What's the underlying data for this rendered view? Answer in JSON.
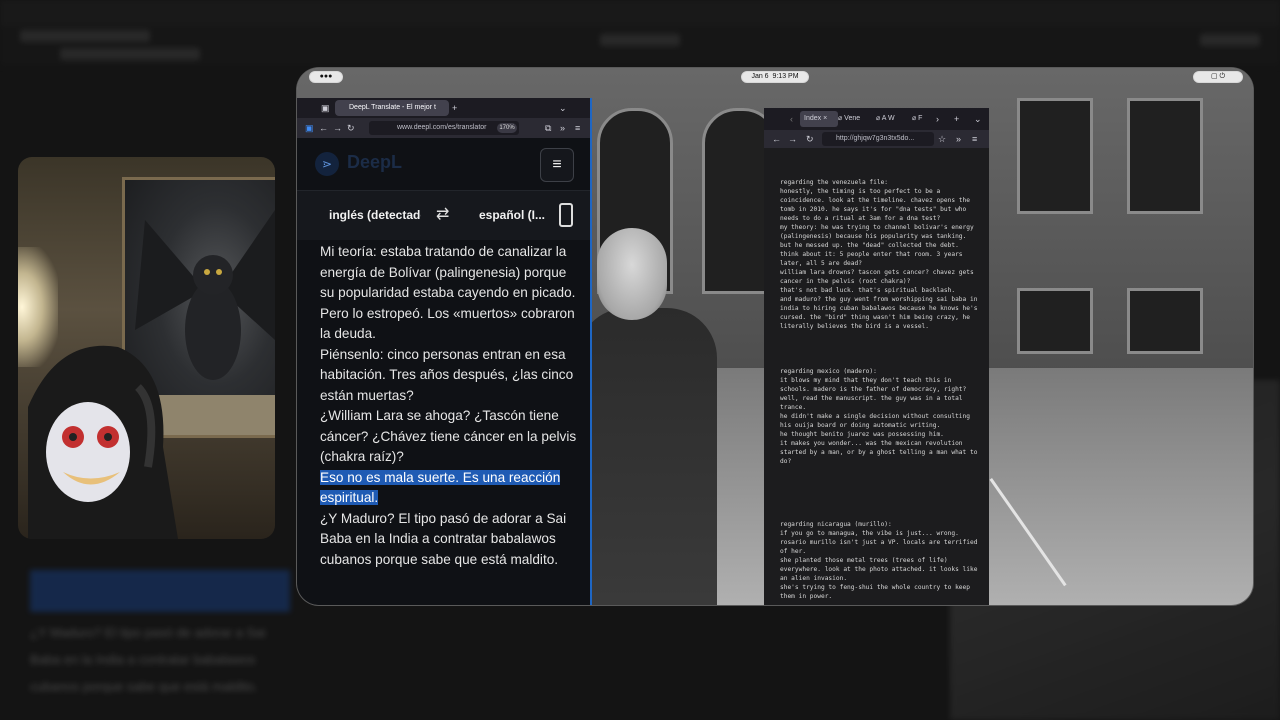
{
  "status_bar": {
    "date": "Jan 6",
    "time": "9:13 PM"
  },
  "deepl_browser": {
    "tab_title": "DeepL Translate - El mejor t",
    "url": "www.deepl.com/es/translator",
    "zoom": "170%",
    "logo_text": "DeepL",
    "source_lang": "inglés (detectado)",
    "target_lang": "español (I...",
    "paragraphs": [
      "Mi teoría: estaba tratando de canalizar la energía de Bolívar (palingenesia) porque su popularidad estaba cayendo en picado.",
      "Pero lo estropeó. Los «muertos» cobraron la deuda.",
      "Piénsenlo: cinco personas entran en esa habitación. Tres años después, ¿las cinco están muertas?",
      "¿William Lara se ahoga? ¿Tascón tiene cáncer? ¿Chávez tiene cáncer en la pelvis (chakra raíz)?"
    ],
    "highlighted": "Eso no es mala suerte. Es una reacción espiritual.",
    "after": "¿Y Maduro? El tipo pasó de adorar a Sai Baba en la India a contratar babalawos cubanos porque sabe que está maldito."
  },
  "tor_browser": {
    "tabs": [
      "Index",
      "Vene",
      "A W",
      "F"
    ],
    "url": "http://ghjqw7g3n3tx5do...",
    "blocks": [
      "regarding the venezuela file:\nhonestly, the timing is too perfect to be a coincidence. look at the timeline. chavez opens the tomb in 2010. he says it's for \"dna tests\" but who needs to do a ritual at 3am for a dna test?\nmy theory: he was trying to channel bolivar's energy (palingenesis) because his popularity was tanking.\nbut he messed up. the \"dead\" collected the debt.\nthink about it: 5 people enter that room. 3 years later, all 5 are dead?\nwilliam lara drowns? tascon gets cancer? chavez gets cancer in the pelvis (root chakra)?\nthat's not bad luck. that's spiritual backlash.\nand maduro? the guy went from worshipping sai baba in india to hiring cuban babalawos because he knows he's cursed. the \"bird\" thing wasn't him being crazy, he literally believes the bird is a vessel.",
      "regarding mexico (madero):\nit blows my mind that they don't teach this in schools. madero is the father of democracy, right?\nwell, read the manuscript. the guy was in a total trance.\nhe didn't make a single decision without consulting his ouija board or doing automatic writing.\nhe thought benito juarez was possessing him.\nit makes you wonder... was the mexican revolution started by a man, or by a ghost telling a man what to do?",
      "regarding nicaragua (murillo):\nif you go to managua, the vibe is just... wrong.\nrosario murillo isn't just a VP. locals are terrified of her.\nshe planted those metal trees (trees of life) everywhere. look at the photo attached. it looks like an alien invasion.\nshe's trying to feng-shui the whole country to keep them in power."
    ]
  }
}
